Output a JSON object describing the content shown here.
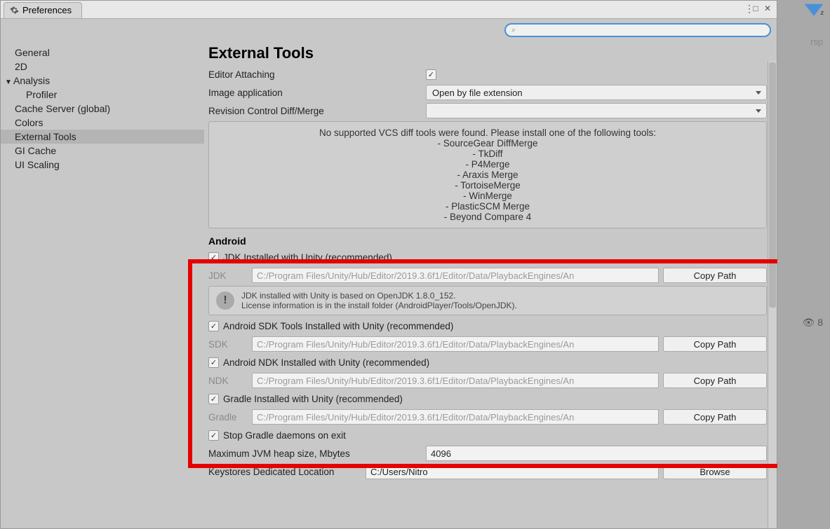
{
  "window": {
    "tab_title": "Preferences",
    "search_placeholder": ""
  },
  "sidebar": {
    "items": [
      {
        "label": "General"
      },
      {
        "label": "2D"
      },
      {
        "label": "Analysis",
        "expanded": true
      },
      {
        "label": "Profiler",
        "child": true
      },
      {
        "label": "Cache Server (global)"
      },
      {
        "label": "Colors"
      },
      {
        "label": "External Tools",
        "selected": true
      },
      {
        "label": "GI Cache"
      },
      {
        "label": "UI Scaling"
      }
    ]
  },
  "main": {
    "title": "External Tools",
    "editor_attaching_label": "Editor Attaching",
    "image_app_label": "Image application",
    "image_app_value": "Open by file extension",
    "revision_label": "Revision Control Diff/Merge",
    "revision_value": "",
    "vcs_info": {
      "heading": "No supported VCS diff tools were found. Please install one of the following tools:",
      "tools": [
        "SourceGear DiffMerge",
        "TkDiff",
        "P4Merge",
        "Araxis Merge",
        "TortoiseMerge",
        "WinMerge",
        "PlasticSCM Merge",
        "Beyond Compare 4"
      ]
    },
    "android": {
      "title": "Android",
      "jdk_check_label": "JDK Installed with Unity (recommended)",
      "jdk_label": "JDK",
      "jdk_path": "C:/Program Files/Unity/Hub/Editor/2019.3.6f1/Editor/Data/PlaybackEngines/An",
      "jdk_copy": "Copy Path",
      "jdk_note1": "JDK installed with Unity is based on OpenJDK 1.8.0_152.",
      "jdk_note2": "License information is in the install folder (AndroidPlayer/Tools/OpenJDK).",
      "sdk_check_label": "Android SDK Tools Installed with Unity (recommended)",
      "sdk_label": "SDK",
      "sdk_path": "C:/Program Files/Unity/Hub/Editor/2019.3.6f1/Editor/Data/PlaybackEngines/An",
      "sdk_copy": "Copy Path",
      "ndk_check_label": "Android NDK Installed with Unity (recommended)",
      "ndk_label": "NDK",
      "ndk_path": "C:/Program Files/Unity/Hub/Editor/2019.3.6f1/Editor/Data/PlaybackEngines/An",
      "ndk_copy": "Copy Path",
      "gradle_check_label": "Gradle Installed with Unity (recommended)",
      "gradle_label": "Gradle",
      "gradle_path": "C:/Program Files/Unity/Hub/Editor/2019.3.6f1/Editor/Data/PlaybackEngines/An",
      "gradle_copy": "Copy Path",
      "stop_daemons_label": "Stop Gradle daemons on exit",
      "heap_label": "Maximum JVM heap size, Mbytes",
      "heap_value": "4096",
      "keystore_label": "Keystores Dedicated Location",
      "keystore_value": "C:/Users/Nitro",
      "browse": "Browse"
    }
  },
  "outside": {
    "persp": "rsp",
    "eye_count": "8",
    "z": "z"
  }
}
